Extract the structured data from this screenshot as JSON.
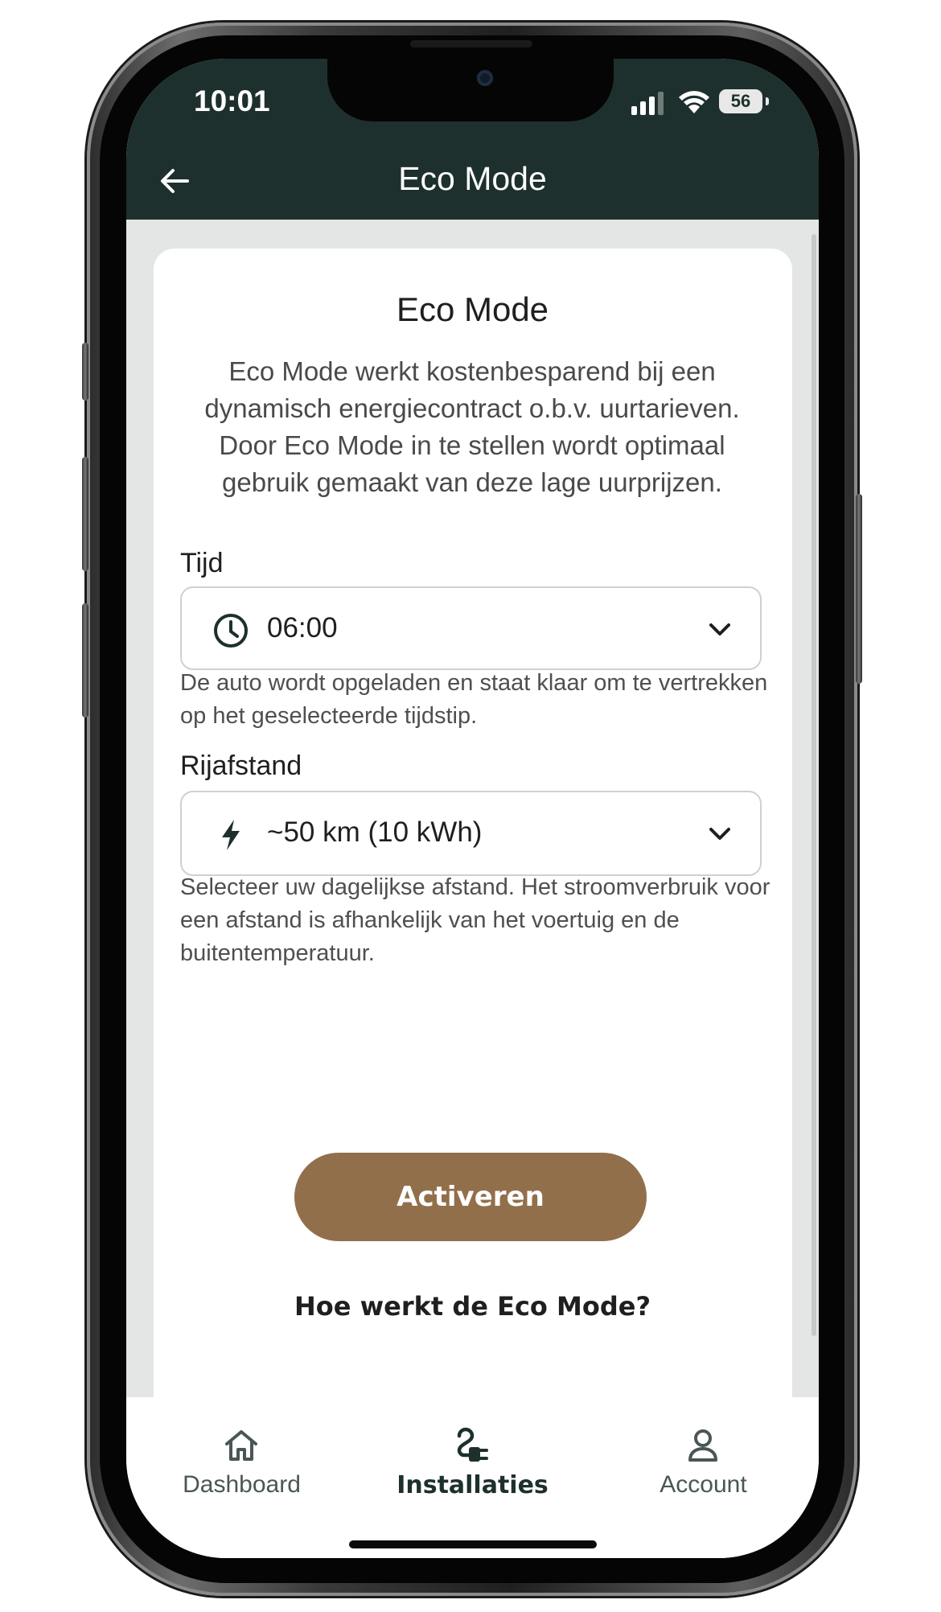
{
  "status_bar": {
    "time": "10:01",
    "battery": "56"
  },
  "header": {
    "title": "Eco Mode",
    "back_icon": "arrow-left-icon"
  },
  "card": {
    "title": "Eco Mode",
    "intro": "Eco Mode werkt kostenbesparend bij een dynamisch energiecontract o.b.v. uurtarieven. Door Eco Mode in te stellen wordt optimaal gebruik gemaakt van deze lage uurprijzen."
  },
  "time_field": {
    "label": "Tijd",
    "value": "06:00",
    "icon": "clock-icon",
    "help": "De auto wordt opgeladen en staat klaar om te vertrekken op het geselecteerde tijdstip."
  },
  "distance_field": {
    "label": "Rijafstand",
    "value": "~50 km (10 kWh)",
    "icon": "lightning-icon",
    "help": "Selecteer uw dagelijkse afstand. Het stroomverbruik voor een afstand is afhankelijk van het voertuig en de buitentemperatuur."
  },
  "activate_label": "Activeren",
  "how_link": "Hoe werkt de Eco Mode?",
  "tabs": [
    {
      "label": "Dashboard",
      "icon": "home-icon",
      "active": false
    },
    {
      "label": "Installaties",
      "icon": "charger-plug-icon",
      "active": true
    },
    {
      "label": "Account",
      "icon": "user-icon",
      "active": false
    }
  ],
  "colors": {
    "header_bg": "#1d302d",
    "accent_button": "#926f4b",
    "page_bg": "#e4e6e6",
    "tab_active": "#1d302d",
    "tab_inactive": "#4a5655"
  }
}
